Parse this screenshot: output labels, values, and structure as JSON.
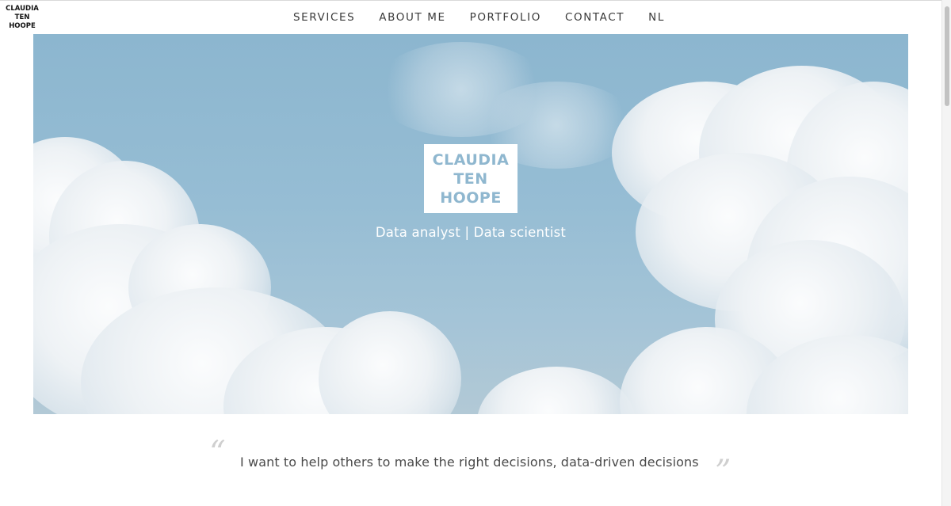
{
  "header": {
    "logo_lines": [
      "CLAUDIA",
      "TEN",
      "HOOPE"
    ],
    "nav": [
      {
        "label": "SERVICES"
      },
      {
        "label": "ABOUT ME"
      },
      {
        "label": "PORTFOLIO"
      },
      {
        "label": "CONTACT"
      },
      {
        "label": "NL"
      }
    ]
  },
  "hero": {
    "logo_lines": [
      "CLAUDIA",
      "TEN",
      "HOOPE"
    ],
    "subtitle": "Data analyst | Data scientist",
    "sky_color": "#8cb6cf",
    "logo_text_color": "#8fb7cf"
  },
  "quote": {
    "open_mark": "“",
    "text": "I want to help others to make the right decisions, data-driven decisions",
    "close_mark": "”"
  }
}
